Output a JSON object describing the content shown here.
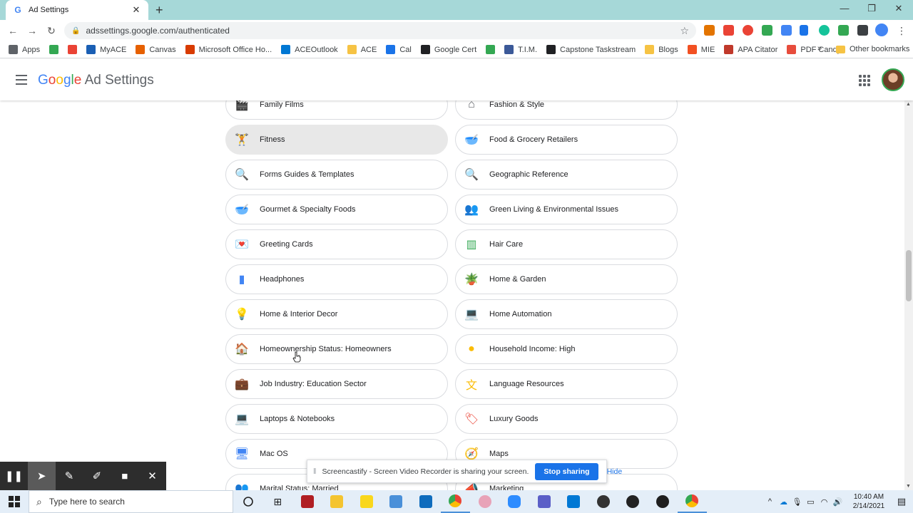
{
  "browser": {
    "tab_title": "Ad Settings",
    "tab_close": "✕",
    "new_tab": "+",
    "url": "adssettings.google.com/authenticated",
    "window_controls": {
      "minimize": "—",
      "restore": "❐",
      "close": "✕"
    }
  },
  "bookmarks": {
    "items": [
      {
        "label": "Apps",
        "color": "#5f6368"
      },
      {
        "label": "",
        "color": "#34a853"
      },
      {
        "label": "",
        "color": "#ea4335"
      },
      {
        "label": "MyACE",
        "color": "#1a5fb4"
      },
      {
        "label": "Canvas",
        "color": "#e66000"
      },
      {
        "label": "Microsoft Office Ho...",
        "color": "#d83b01"
      },
      {
        "label": "ACEOutlook",
        "color": "#0078d4"
      },
      {
        "label": "ACE",
        "color": "#f6c344"
      },
      {
        "label": "Cal",
        "color": "#1a73e8"
      },
      {
        "label": "Google Cert",
        "color": "#202124"
      },
      {
        "label": "",
        "color": "#34a853"
      },
      {
        "label": "T.I.M.",
        "color": "#3b5998"
      },
      {
        "label": "Capstone Taskstream",
        "color": "#202124"
      },
      {
        "label": "Blogs",
        "color": "#f6c344"
      },
      {
        "label": "MIE",
        "color": "#f25022"
      },
      {
        "label": "APA Citator",
        "color": "#c0392b"
      },
      {
        "label": "PDF Candy",
        "color": "#e74c3c"
      }
    ],
    "more": "»",
    "other": "Other bookmarks"
  },
  "header": {
    "logo_letters": [
      "G",
      "o",
      "o",
      "g",
      "l",
      "e"
    ],
    "product": "Ad Settings"
  },
  "topics": [
    {
      "label": "Family Films",
      "icon": "clapperboard-icon",
      "glyph": "🎬"
    },
    {
      "label": "Fashion & Style",
      "icon": "hanger-icon",
      "glyph": "⌂"
    },
    {
      "label": "Fitness",
      "icon": "dumbbell-icon",
      "glyph": "🏋"
    },
    {
      "label": "Food & Grocery Retailers",
      "icon": "bowl-icon",
      "glyph": "🥣"
    },
    {
      "label": "Forms Guides & Templates",
      "icon": "document-search-icon",
      "glyph": "🔍"
    },
    {
      "label": "Geographic Reference",
      "icon": "document-search-icon",
      "glyph": "🔍"
    },
    {
      "label": "Gourmet & Specialty Foods",
      "icon": "bowl-icon",
      "glyph": "🥣"
    },
    {
      "label": "Green Living & Environmental Issues",
      "icon": "people-icon",
      "glyph": "👥"
    },
    {
      "label": "Greeting Cards",
      "icon": "card-icon",
      "glyph": "💌"
    },
    {
      "label": "Hair Care",
      "icon": "comb-icon",
      "glyph": "▥"
    },
    {
      "label": "Headphones",
      "icon": "sound-wave-icon",
      "glyph": "▮"
    },
    {
      "label": "Home & Garden",
      "icon": "potted-plant-icon",
      "glyph": "🪴"
    },
    {
      "label": "Home & Interior Decor",
      "icon": "lamp-icon",
      "glyph": "💡"
    },
    {
      "label": "Home Automation",
      "icon": "laptop-icon",
      "glyph": "💻"
    },
    {
      "label": "Homeownership Status: Homeowners",
      "icon": "house-icon",
      "glyph": "🏠"
    },
    {
      "label": "Household Income: High",
      "icon": "coin-icon",
      "glyph": "●"
    },
    {
      "label": "Job Industry: Education Sector",
      "icon": "briefcase-icon",
      "glyph": "💼"
    },
    {
      "label": "Language Resources",
      "icon": "translate-icon",
      "glyph": "文"
    },
    {
      "label": "Laptops & Notebooks",
      "icon": "laptop-icon",
      "glyph": "💻"
    },
    {
      "label": "Luxury Goods",
      "icon": "tag-icon",
      "glyph": "🏷"
    },
    {
      "label": "Mac OS",
      "icon": "monitor-icon",
      "glyph": "🖥"
    },
    {
      "label": "Maps",
      "icon": "compass-icon",
      "glyph": "🧭"
    },
    {
      "label": "Marital Status: Married",
      "icon": "people-icon",
      "glyph": "👥"
    },
    {
      "label": "Marketing",
      "icon": "megaphone-icon",
      "glyph": "📣"
    }
  ],
  "icon_colors": {
    "clapperboard-icon": "#202124",
    "hanger-icon": "#5f6368",
    "dumbbell-icon": "#9aa0a6",
    "bowl-icon": "#ea4335",
    "document-search-icon": "#4285f4",
    "people-icon": "#4285f4",
    "card-icon": "#ea4335",
    "comb-icon": "#34a853",
    "sound-wave-icon": "#4285f4",
    "potted-plant-icon": "#34a853",
    "lamp-icon": "#4285f4",
    "laptop-icon": "#5f6368",
    "house-icon": "#ea4335",
    "coin-icon": "#fbbc05",
    "briefcase-icon": "#5f6368",
    "translate-icon": "#fbbc05",
    "tag-icon": "#ea4335",
    "monitor-icon": "#4285f4",
    "compass-icon": "#fbbc05",
    "megaphone-icon": "#4285f4"
  },
  "active_topic": "Fitness",
  "screencastify": {
    "message": "Screencastify - Screen Video Recorder is sharing your screen.",
    "stop_label": "Stop sharing",
    "hide_label": "Hide"
  },
  "taskbar": {
    "search_placeholder": "Type here to search",
    "time": "10:40 AM",
    "date": "2/14/2021"
  }
}
